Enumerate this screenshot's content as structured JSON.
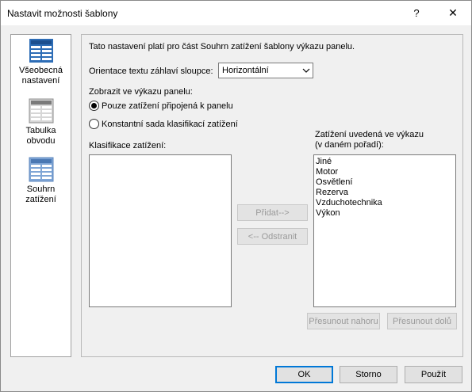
{
  "window": {
    "title": "Nastavit možnosti šablony",
    "help_label": "?",
    "close_label": "✕"
  },
  "sidebar": {
    "items": [
      {
        "label": "Všeobecná nastavení",
        "icon": "general-settings-icon"
      },
      {
        "label": "Tabulka obvodu",
        "icon": "circuit-table-icon"
      },
      {
        "label": "Souhrn zatížení",
        "icon": "load-summary-icon"
      }
    ],
    "selected": 2
  },
  "panel": {
    "description": "Tato nastavení platí pro část Souhrn zatížení šablony výkazu panelu.",
    "orientation_label": "Orientace textu záhlaví sloupce:",
    "orientation_value": "Horizontální",
    "display_label": "Zobrazit ve výkazu panelu:",
    "radio_connected": "Pouze zatížení připojená k panelu",
    "radio_constant": "Konstantní sada klasifikací zatížení",
    "radio_selected": "connected",
    "classifications_label": "Klasifikace zatížení:",
    "classifications_items": [],
    "listed_label_line1": "Zatížení uvedená ve výkazu",
    "listed_label_line2": "(v daném pořadí):",
    "listed_items": [
      "Jiné",
      "Motor",
      "Osvětlení",
      "Rezerva",
      "Vzduchotechnika",
      "Výkon"
    ],
    "add_button": "Přidat-->",
    "remove_button": "<-- Odstranit",
    "move_up_button": "Přesunout nahoru",
    "move_down_button": "Přesunout dolů"
  },
  "footer": {
    "ok": "OK",
    "cancel": "Storno",
    "apply": "Použít"
  },
  "colors": {
    "accent": "#0078d7",
    "icon_blue": "#2d6db6"
  }
}
